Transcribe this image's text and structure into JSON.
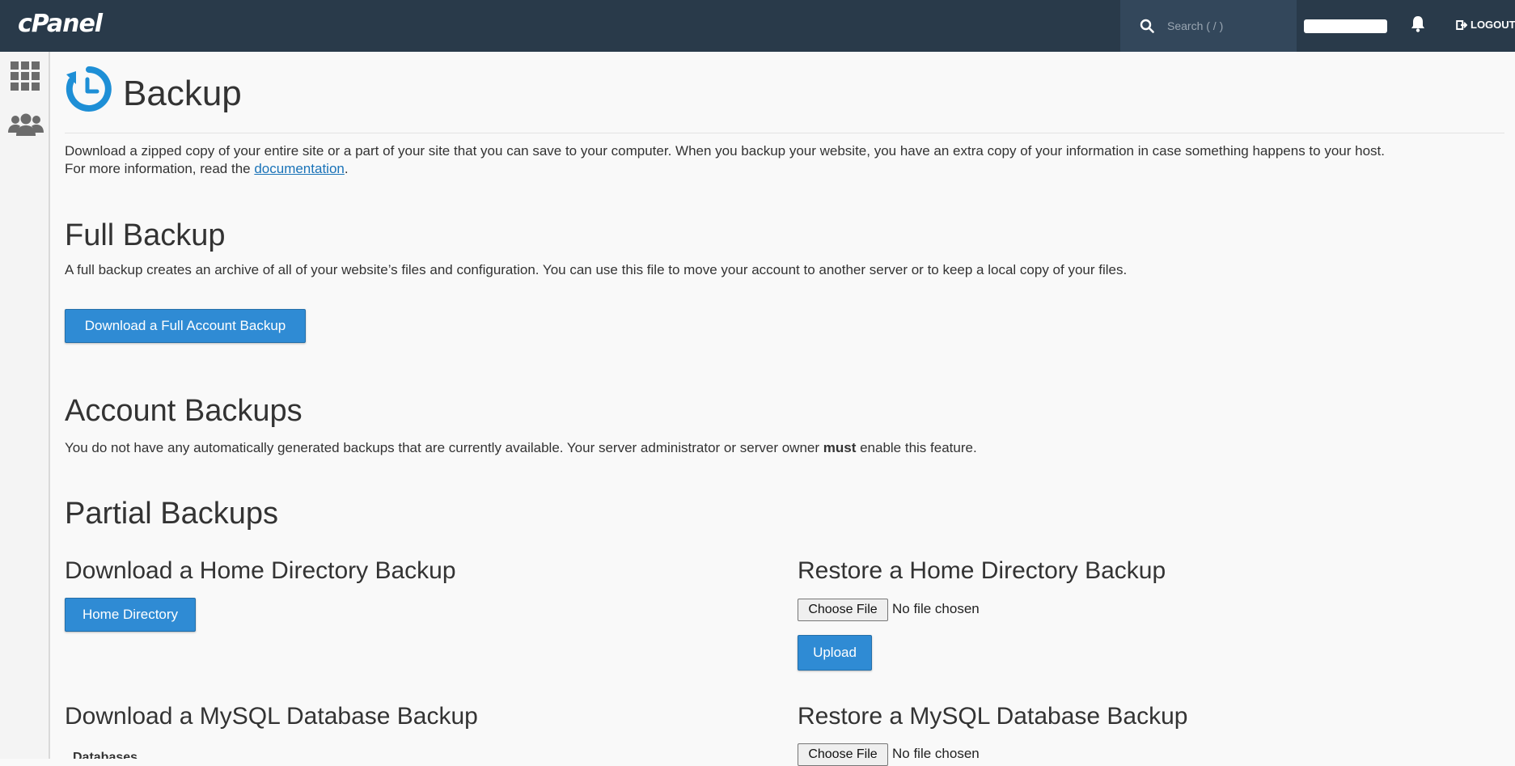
{
  "topbar": {
    "logo_text": "cPanel",
    "search_placeholder": "Search ( / )",
    "logout_label": "LOGOUT"
  },
  "page": {
    "title": "Backup",
    "intro_line1": "Download a zipped copy of your entire site or a part of your site that you can save to your computer. When you backup your website, you have an extra copy of your information in case something happens to your host.",
    "intro_line2_prefix": "For more information, read the ",
    "intro_link": "documentation",
    "intro_line2_suffix": "."
  },
  "full_backup": {
    "heading": "Full Backup",
    "description": "A full backup creates an archive of all of your website’s files and configuration. You can use this file to move your account to another server or to keep a local copy of your files.",
    "button_label": "Download a Full Account Backup"
  },
  "account_backups": {
    "heading": "Account Backups",
    "description_prefix": "You do not have any automatically generated backups that are currently available. Your server administrator or server owner ",
    "description_bold": "must",
    "description_suffix": " enable this feature."
  },
  "partial_backups": {
    "heading": "Partial Backups",
    "download_home": {
      "heading": "Download a Home Directory Backup",
      "button_label": "Home Directory"
    },
    "restore_home": {
      "heading": "Restore a Home Directory Backup",
      "choose_label": "Choose File",
      "file_status": "No file chosen",
      "upload_label": "Upload"
    },
    "download_mysql": {
      "heading": "Download a MySQL Database Backup",
      "cut_label": "Databases"
    },
    "restore_mysql": {
      "heading": "Restore a MySQL Database Backup",
      "choose_label": "Choose File",
      "file_status": "No file chosen"
    }
  },
  "icons": {
    "search": "search-icon",
    "bell": "bell-icon",
    "logout": "logout-icon",
    "apps": "grid-icon",
    "users": "users-icon",
    "backup": "backup-clock-icon"
  },
  "colors": {
    "topbar_bg": "#293a4a",
    "primary_button": "#2f8bd4",
    "backup_icon": "#1e8fd6",
    "link": "#1a73b8"
  }
}
